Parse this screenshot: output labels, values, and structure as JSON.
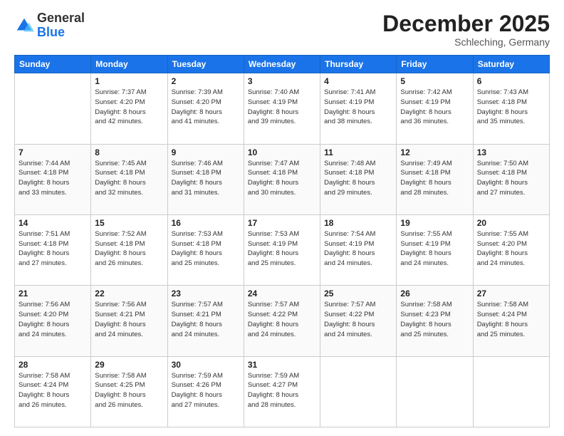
{
  "header": {
    "logo": {
      "general": "General",
      "blue": "Blue"
    },
    "title": "December 2025",
    "location": "Schleching, Germany"
  },
  "calendar": {
    "days_of_week": [
      "Sunday",
      "Monday",
      "Tuesday",
      "Wednesday",
      "Thursday",
      "Friday",
      "Saturday"
    ],
    "weeks": [
      [
        null,
        {
          "day": "1",
          "sunrise": "Sunrise: 7:37 AM",
          "sunset": "Sunset: 4:20 PM",
          "daylight": "Daylight: 8 hours and 42 minutes."
        },
        {
          "day": "2",
          "sunrise": "Sunrise: 7:39 AM",
          "sunset": "Sunset: 4:20 PM",
          "daylight": "Daylight: 8 hours and 41 minutes."
        },
        {
          "day": "3",
          "sunrise": "Sunrise: 7:40 AM",
          "sunset": "Sunset: 4:19 PM",
          "daylight": "Daylight: 8 hours and 39 minutes."
        },
        {
          "day": "4",
          "sunrise": "Sunrise: 7:41 AM",
          "sunset": "Sunset: 4:19 PM",
          "daylight": "Daylight: 8 hours and 38 minutes."
        },
        {
          "day": "5",
          "sunrise": "Sunrise: 7:42 AM",
          "sunset": "Sunset: 4:19 PM",
          "daylight": "Daylight: 8 hours and 36 minutes."
        },
        {
          "day": "6",
          "sunrise": "Sunrise: 7:43 AM",
          "sunset": "Sunset: 4:18 PM",
          "daylight": "Daylight: 8 hours and 35 minutes."
        }
      ],
      [
        {
          "day": "7",
          "sunrise": "Sunrise: 7:44 AM",
          "sunset": "Sunset: 4:18 PM",
          "daylight": "Daylight: 8 hours and 33 minutes."
        },
        {
          "day": "8",
          "sunrise": "Sunrise: 7:45 AM",
          "sunset": "Sunset: 4:18 PM",
          "daylight": "Daylight: 8 hours and 32 minutes."
        },
        {
          "day": "9",
          "sunrise": "Sunrise: 7:46 AM",
          "sunset": "Sunset: 4:18 PM",
          "daylight": "Daylight: 8 hours and 31 minutes."
        },
        {
          "day": "10",
          "sunrise": "Sunrise: 7:47 AM",
          "sunset": "Sunset: 4:18 PM",
          "daylight": "Daylight: 8 hours and 30 minutes."
        },
        {
          "day": "11",
          "sunrise": "Sunrise: 7:48 AM",
          "sunset": "Sunset: 4:18 PM",
          "daylight": "Daylight: 8 hours and 29 minutes."
        },
        {
          "day": "12",
          "sunrise": "Sunrise: 7:49 AM",
          "sunset": "Sunset: 4:18 PM",
          "daylight": "Daylight: 8 hours and 28 minutes."
        },
        {
          "day": "13",
          "sunrise": "Sunrise: 7:50 AM",
          "sunset": "Sunset: 4:18 PM",
          "daylight": "Daylight: 8 hours and 27 minutes."
        }
      ],
      [
        {
          "day": "14",
          "sunrise": "Sunrise: 7:51 AM",
          "sunset": "Sunset: 4:18 PM",
          "daylight": "Daylight: 8 hours and 27 minutes."
        },
        {
          "day": "15",
          "sunrise": "Sunrise: 7:52 AM",
          "sunset": "Sunset: 4:18 PM",
          "daylight": "Daylight: 8 hours and 26 minutes."
        },
        {
          "day": "16",
          "sunrise": "Sunrise: 7:53 AM",
          "sunset": "Sunset: 4:18 PM",
          "daylight": "Daylight: 8 hours and 25 minutes."
        },
        {
          "day": "17",
          "sunrise": "Sunrise: 7:53 AM",
          "sunset": "Sunset: 4:19 PM",
          "daylight": "Daylight: 8 hours and 25 minutes."
        },
        {
          "day": "18",
          "sunrise": "Sunrise: 7:54 AM",
          "sunset": "Sunset: 4:19 PM",
          "daylight": "Daylight: 8 hours and 24 minutes."
        },
        {
          "day": "19",
          "sunrise": "Sunrise: 7:55 AM",
          "sunset": "Sunset: 4:19 PM",
          "daylight": "Daylight: 8 hours and 24 minutes."
        },
        {
          "day": "20",
          "sunrise": "Sunrise: 7:55 AM",
          "sunset": "Sunset: 4:20 PM",
          "daylight": "Daylight: 8 hours and 24 minutes."
        }
      ],
      [
        {
          "day": "21",
          "sunrise": "Sunrise: 7:56 AM",
          "sunset": "Sunset: 4:20 PM",
          "daylight": "Daylight: 8 hours and 24 minutes."
        },
        {
          "day": "22",
          "sunrise": "Sunrise: 7:56 AM",
          "sunset": "Sunset: 4:21 PM",
          "daylight": "Daylight: 8 hours and 24 minutes."
        },
        {
          "day": "23",
          "sunrise": "Sunrise: 7:57 AM",
          "sunset": "Sunset: 4:21 PM",
          "daylight": "Daylight: 8 hours and 24 minutes."
        },
        {
          "day": "24",
          "sunrise": "Sunrise: 7:57 AM",
          "sunset": "Sunset: 4:22 PM",
          "daylight": "Daylight: 8 hours and 24 minutes."
        },
        {
          "day": "25",
          "sunrise": "Sunrise: 7:57 AM",
          "sunset": "Sunset: 4:22 PM",
          "daylight": "Daylight: 8 hours and 24 minutes."
        },
        {
          "day": "26",
          "sunrise": "Sunrise: 7:58 AM",
          "sunset": "Sunset: 4:23 PM",
          "daylight": "Daylight: 8 hours and 25 minutes."
        },
        {
          "day": "27",
          "sunrise": "Sunrise: 7:58 AM",
          "sunset": "Sunset: 4:24 PM",
          "daylight": "Daylight: 8 hours and 25 minutes."
        }
      ],
      [
        {
          "day": "28",
          "sunrise": "Sunrise: 7:58 AM",
          "sunset": "Sunset: 4:24 PM",
          "daylight": "Daylight: 8 hours and 26 minutes."
        },
        {
          "day": "29",
          "sunrise": "Sunrise: 7:58 AM",
          "sunset": "Sunset: 4:25 PM",
          "daylight": "Daylight: 8 hours and 26 minutes."
        },
        {
          "day": "30",
          "sunrise": "Sunrise: 7:59 AM",
          "sunset": "Sunset: 4:26 PM",
          "daylight": "Daylight: 8 hours and 27 minutes."
        },
        {
          "day": "31",
          "sunrise": "Sunrise: 7:59 AM",
          "sunset": "Sunset: 4:27 PM",
          "daylight": "Daylight: 8 hours and 28 minutes."
        },
        null,
        null,
        null
      ]
    ]
  }
}
